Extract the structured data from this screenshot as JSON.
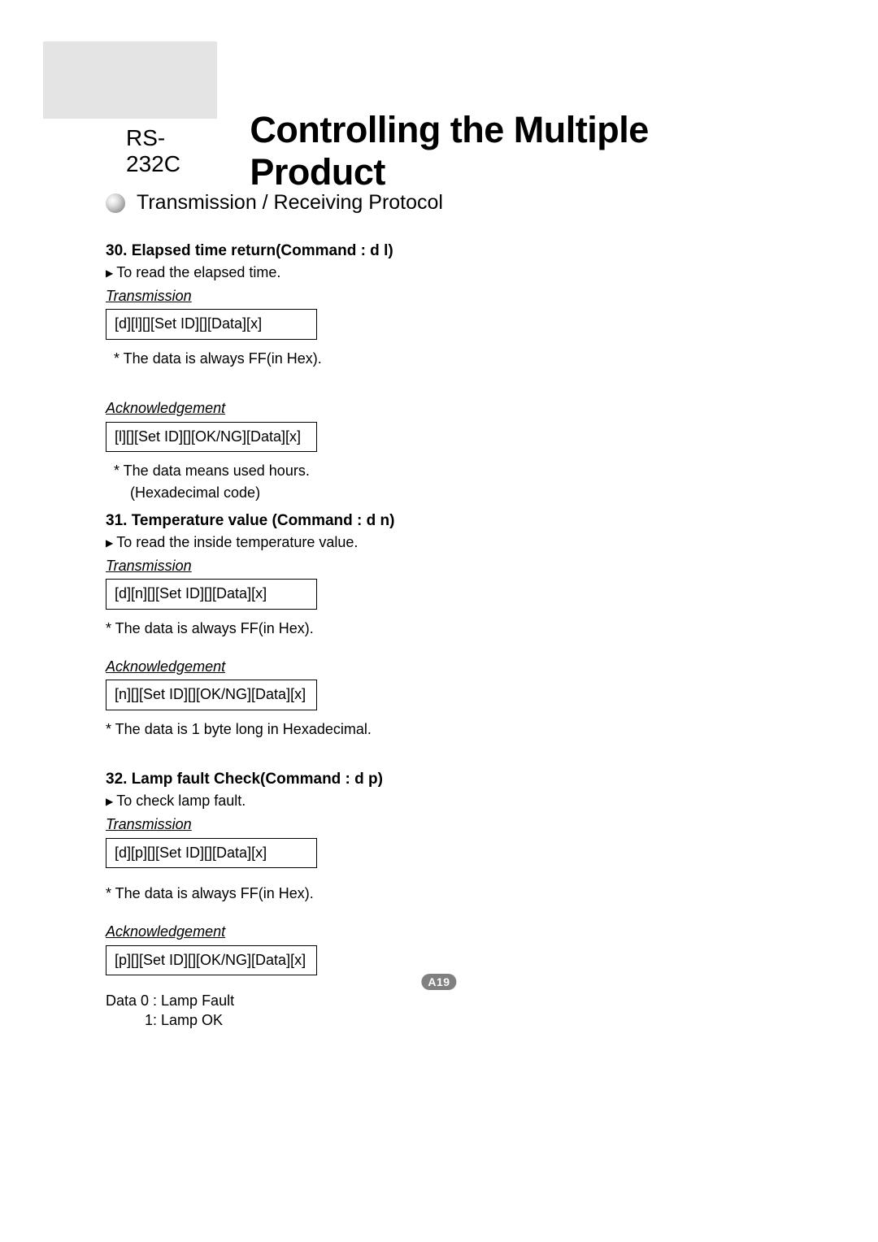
{
  "header": {
    "prefix": "RS-232C",
    "main": "Controlling the Multiple Product"
  },
  "section": {
    "title": "Transmission / Receiving Protocol"
  },
  "cmd30": {
    "title": "30. Elapsed time return(Command : d l)",
    "desc": "To read the elapsed time.",
    "trans_label": "Transmission",
    "trans_code": "[d][l][][Set ID][][Data][x]",
    "trans_note": "* The data is always FF(in Hex).",
    "ack_label": "Acknowledgement",
    "ack_code": "[l][][Set ID][][OK/NG][Data][x]",
    "ack_note1": "* The data means used hours.",
    "ack_note2": "(Hexadecimal code)"
  },
  "cmd31": {
    "title": "31. Temperature value (Command : d n)",
    "desc": "To read the inside temperature value.",
    "trans_label": "Transmission",
    "trans_code": "[d][n][][Set ID][][Data][x]",
    "trans_note": "* The data is always FF(in Hex).",
    "ack_label": "Acknowledgement",
    "ack_code": "[n][][Set ID][][OK/NG][Data][x]",
    "ack_note": "* The data  is 1 byte long in Hexadecimal."
  },
  "cmd32": {
    "title": "32. Lamp fault Check(Command : d p)",
    "desc": "To check lamp fault.",
    "trans_label": "Transmission",
    "trans_code": "[d][p][][Set ID][][Data][x]",
    "trans_note": "* The data is always FF(in Hex).",
    "ack_label": "Acknowledgement",
    "ack_code": "[p][][Set ID][][OK/NG][Data][x]",
    "data_line1": "Data 0 : Lamp Fault",
    "data_line2": "1: Lamp OK"
  },
  "page_number": "A19"
}
